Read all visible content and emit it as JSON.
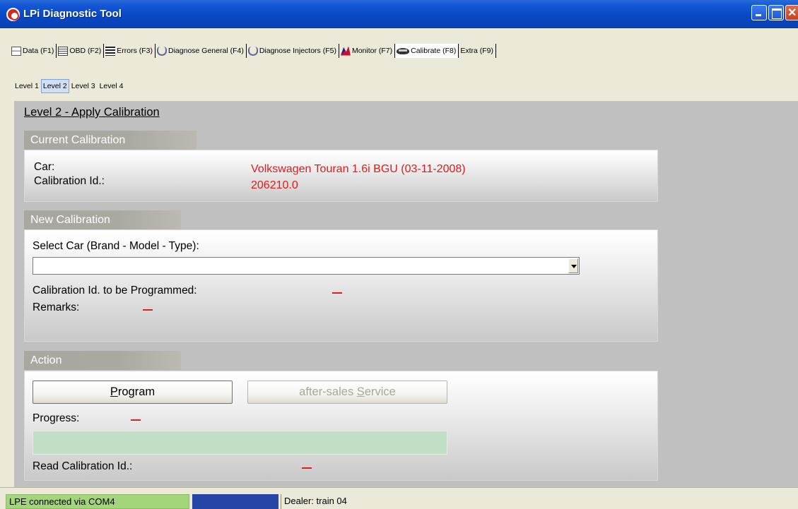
{
  "window": {
    "title": "LPi Diagnostic Tool"
  },
  "menu": {
    "items": [
      {
        "label": "Data (F1)",
        "icon": "data-sheet-icon"
      },
      {
        "label": "OBD (F2)",
        "icon": "obd-table-icon"
      },
      {
        "label": "Errors (F3)",
        "icon": "errors-list-icon"
      },
      {
        "label": "Diagnose General (F4)",
        "icon": "stethoscope-icon"
      },
      {
        "label": "Diagnose Injectors (F5)",
        "icon": "stethoscope-icon"
      },
      {
        "label": "Monitor (F7)",
        "icon": "monitor-chart-icon"
      },
      {
        "label": "Calibrate (F8)",
        "icon": "chip-icon",
        "active": true
      },
      {
        "label": "Extra (F9)"
      }
    ]
  },
  "subtabs": [
    "Level 1",
    "Level 2",
    "Level 3",
    "Level 4"
  ],
  "active_subtab": "Level 2",
  "page": {
    "title": "Level 2 - Apply Calibration"
  },
  "current": {
    "header": "Current Calibration",
    "car_label": "Car:",
    "car_value": "Volkswagen Touran 1.6i BGU (03-11-2008)",
    "calib_label": "Calibration Id.:",
    "calib_value": "206210.0"
  },
  "newcal": {
    "header": "New Calibration",
    "select_label": "Select Car (Brand - Model - Type):",
    "select_value": "",
    "calib_label": "Calibration Id. to be Programmed:",
    "remarks_label": "Remarks:"
  },
  "action": {
    "header": "Action",
    "program_label": "Program",
    "service_label": "after-sales Service",
    "progress_label": "Progress:",
    "progress_value": 0,
    "read_label": "Read Calibration Id.:"
  },
  "status": {
    "connection": "LPE connected via COM4",
    "dealer": "Dealer: train 04"
  },
  "colors": {
    "title_bar": "#0a47c4",
    "value_red": "#e01c1c",
    "progress_fill": "#bfe0c4",
    "status_connected": "#a3d67a",
    "status_progress": "#2546a6"
  }
}
